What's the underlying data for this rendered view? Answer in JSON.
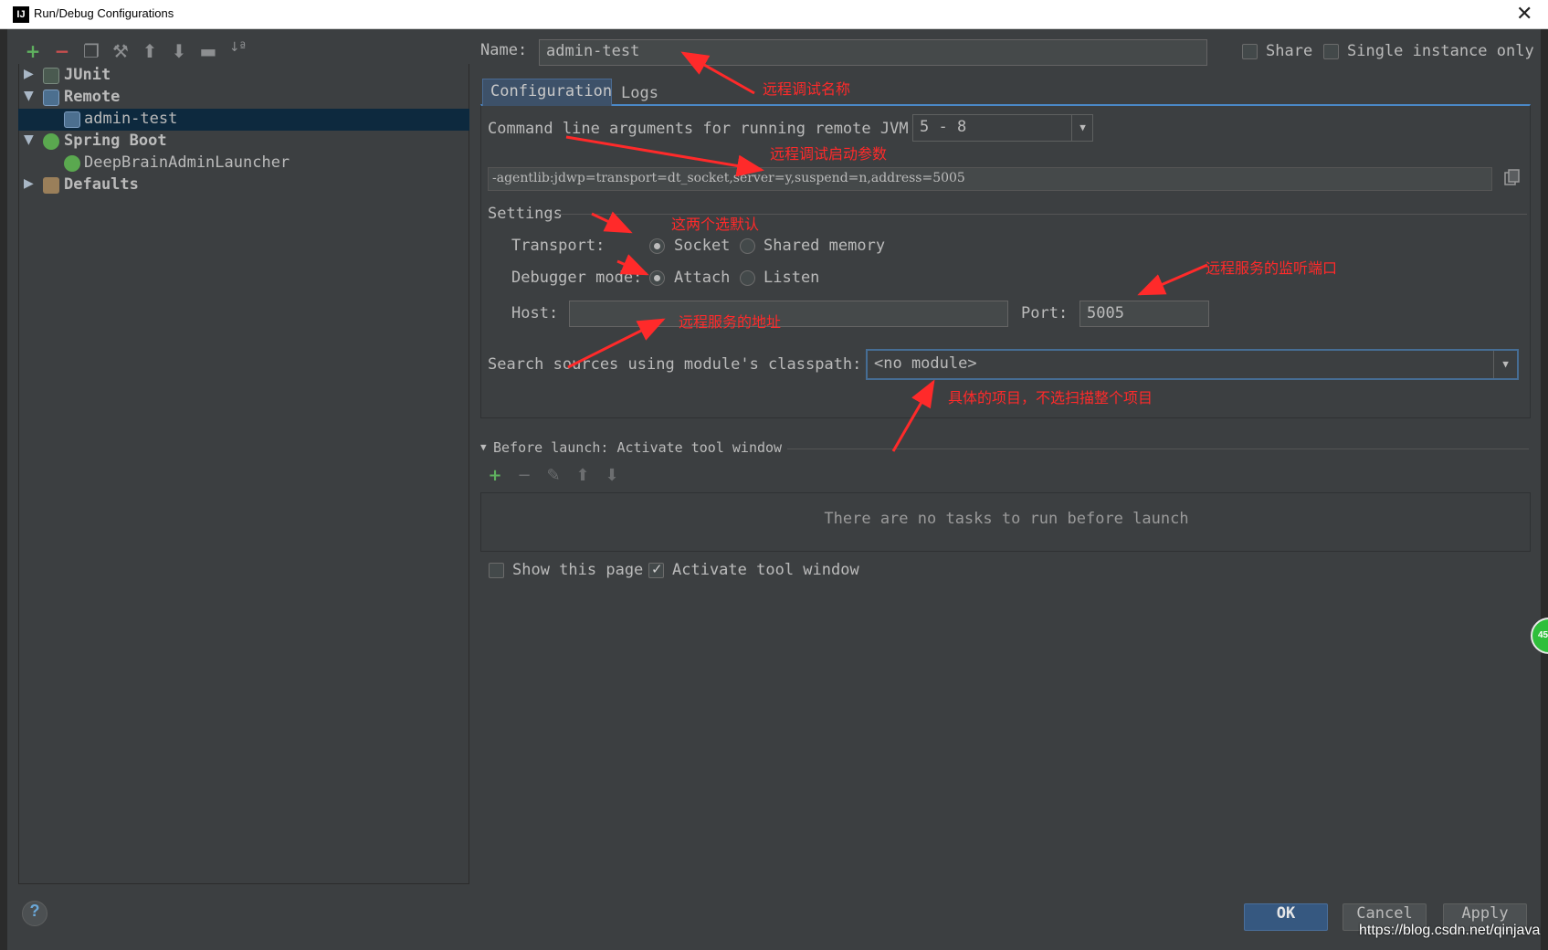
{
  "window": {
    "title": "Run/Debug Configurations",
    "icon_text": "IJ"
  },
  "toolbar": {
    "icons": [
      "add-icon",
      "remove-icon",
      "copy-icon",
      "wrench-icon",
      "arrow-up-icon",
      "arrow-down-icon",
      "folder-icon",
      "sort-icon"
    ]
  },
  "tree": {
    "junit": "JUnit",
    "remote": "Remote",
    "admin_test": "admin-test",
    "spring_boot": "Spring Boot",
    "launcher": "DeepBrainAdminLauncher",
    "defaults": "Defaults"
  },
  "name_row": {
    "label": "Name:",
    "value": "admin-test",
    "share_label": "Share",
    "single_instance_label": "Single instance only"
  },
  "tabs": {
    "configuration": "Configuration",
    "logs": "Logs"
  },
  "config": {
    "cmd_label": "Command line arguments for running remote JVM",
    "jvm_version": "5 - 8",
    "agent_args": "-agentlib:jdwp=transport=dt_socket,server=y,suspend=n,address=5005",
    "settings_label": "Settings",
    "transport_label": "Transport:",
    "transport_socket": "Socket",
    "transport_shared": "Shared memory",
    "debugger_label": "Debugger mode:",
    "debugger_attach": "Attach",
    "debugger_listen": "Listen",
    "host_label": "Host:",
    "host_value": "",
    "port_label": "Port:",
    "port_value": "5005",
    "module_label": "Search sources using module's classpath:",
    "module_value": "<no module>"
  },
  "before_launch": {
    "label": "Before launch: Activate tool window",
    "empty_text": "There are no tasks to run before launch",
    "show_page_label": "Show this page",
    "activate_label": "Activate tool window",
    "show_page_checked": false,
    "activate_checked": true
  },
  "buttons": {
    "help": "?",
    "ok": "OK",
    "cancel": "Cancel",
    "apply": "Apply"
  },
  "annotations": {
    "debug_name": "远程调试名称",
    "debug_args": "远程调试启动参数",
    "two_defaults": "这两个选默认",
    "listen_port": "远程服务的监听端口",
    "server_address": "远程服务的地址",
    "project_note": "具体的项目，不选扫描整个项目"
  },
  "watermark": "https://blog.csdn.net/qinjava",
  "badge": "45",
  "colors": {
    "background": "#3c3f41",
    "selection": "#0d293e",
    "tab_active": "#3d5169",
    "ok_button": "#365880",
    "annotation": "#ff2a2a"
  }
}
